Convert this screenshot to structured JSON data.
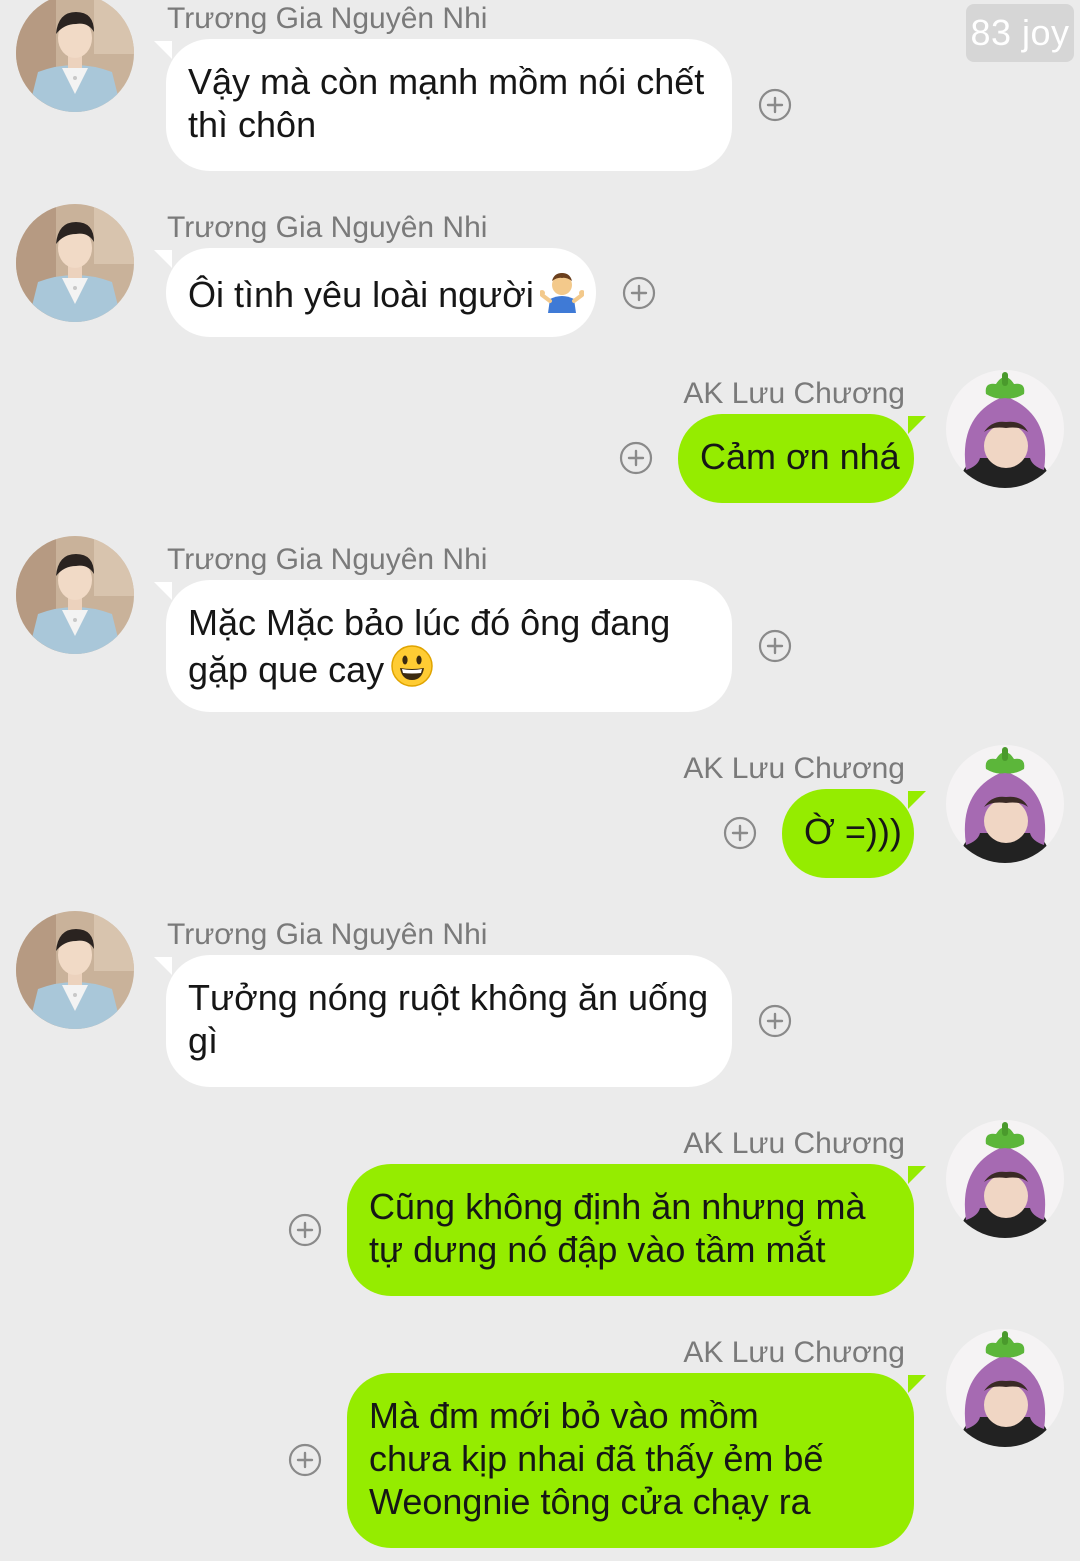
{
  "watermark": "83 joy",
  "contacts": {
    "left_name": "Trương Gia Nguyên Nhi",
    "right_name": "AK Lưu Chương"
  },
  "messages": [
    {
      "sender": "Trương Gia Nguyên Nhi",
      "lines": [
        "Vậy mà còn mạnh mồm nói chết",
        "thì chôn"
      ]
    },
    {
      "sender": "Trương Gia Nguyên Nhi",
      "lines": [
        "Ôi tình yêu loài người"
      ],
      "emoji_icon": "person-shrugging-emoji"
    },
    {
      "sender": "AK Lưu Chương",
      "lines": [
        "Cảm ơn nhá"
      ]
    },
    {
      "sender": "Trương Gia Nguyên Nhi",
      "lines": [
        "Mặc Mặc bảo lúc đó ông đang",
        "gặp que cay"
      ],
      "emoji_icon": "grinning-face-emoji"
    },
    {
      "sender": "AK Lưu Chương",
      "lines": [
        "Ờ =)))"
      ]
    },
    {
      "sender": "Trương Gia Nguyên Nhi",
      "lines": [
        "Tưởng nóng ruột không ăn uống",
        "gì"
      ]
    },
    {
      "sender": "AK Lưu Chương",
      "lines": [
        "Cũng không định ăn nhưng mà",
        "tự dưng nó đập vào tầm mắt"
      ]
    },
    {
      "sender": "AK Lưu Chương",
      "lines": [
        "Mà đm mới bỏ vào mồm",
        "chưa kịp nhai đã thấy ẻm bế",
        "Weongnie tông cửa chạy ra"
      ]
    }
  ],
  "colors": {
    "background": "#ebebeb",
    "incoming_bubble": "#ffffff",
    "outgoing_bubble": "#95ec00",
    "sender_text": "#7a7a7a",
    "message_text": "#161616"
  },
  "icons": {
    "add_reaction": "plus-circle-icon",
    "left_avatar": "boy-in-blue-suit-avatar",
    "right_avatar": "eggplant-hat-avatar"
  }
}
